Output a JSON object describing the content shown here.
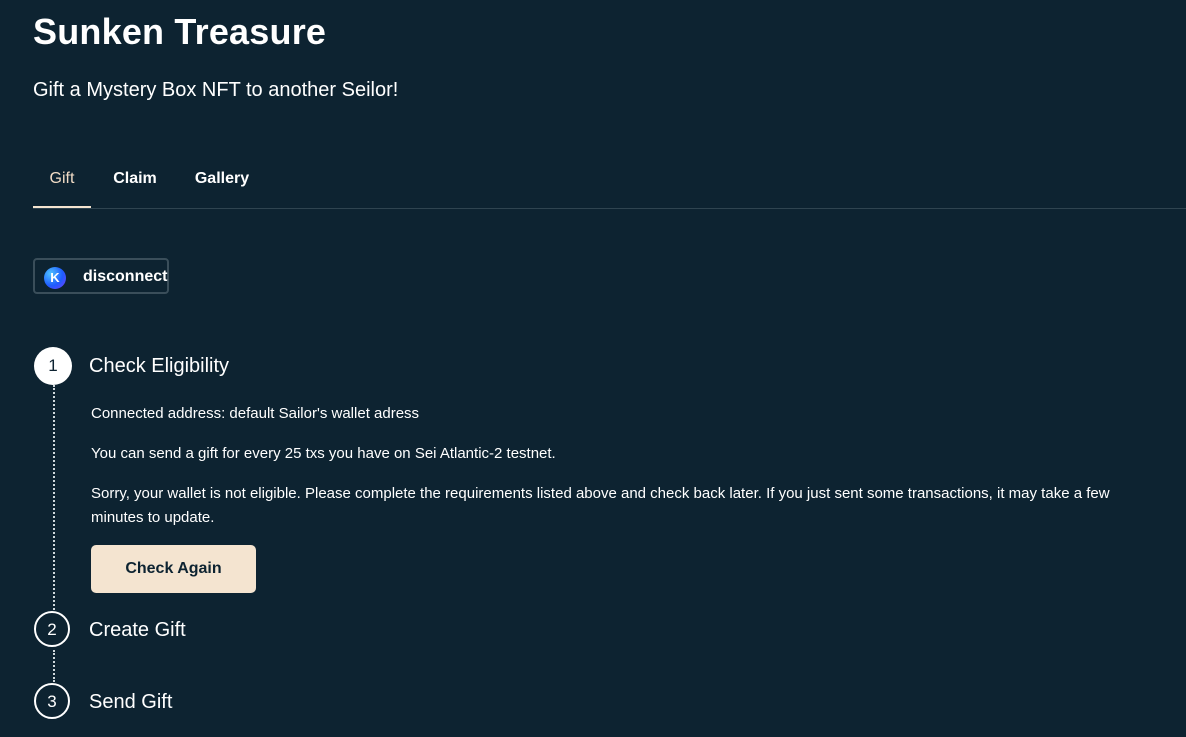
{
  "header": {
    "title": "Sunken Treasure",
    "subtitle": "Gift a Mystery Box NFT to another Seilor!"
  },
  "tabs": [
    {
      "label": "Gift",
      "active": true
    },
    {
      "label": "Claim",
      "active": false
    },
    {
      "label": "Gallery",
      "active": false
    }
  ],
  "wallet": {
    "icon_letter": "K",
    "icon_name": "keplr-wallet-icon",
    "disconnect_label": "disconnect"
  },
  "steps": [
    {
      "number": "1",
      "title": "Check Eligibility",
      "active": true,
      "connected_text": "Connected address: default Sailor's wallet adress",
      "requirement_text": "You can send a gift for every 25 txs you have on Sei Atlantic-2 testnet.",
      "status_text": "Sorry, your wallet is not eligible. Please complete the requirements listed above and check back later. If you just sent some transactions, it may take a few minutes to update.",
      "button_label": "Check Again"
    },
    {
      "number": "2",
      "title": "Create Gift",
      "active": false
    },
    {
      "number": "3",
      "title": "Send Gift",
      "active": false
    }
  ],
  "colors": {
    "background": "#0d2331",
    "accent": "#f4e4d0",
    "active_tab_text": "#f1dcc6",
    "text": "#ffffff"
  }
}
